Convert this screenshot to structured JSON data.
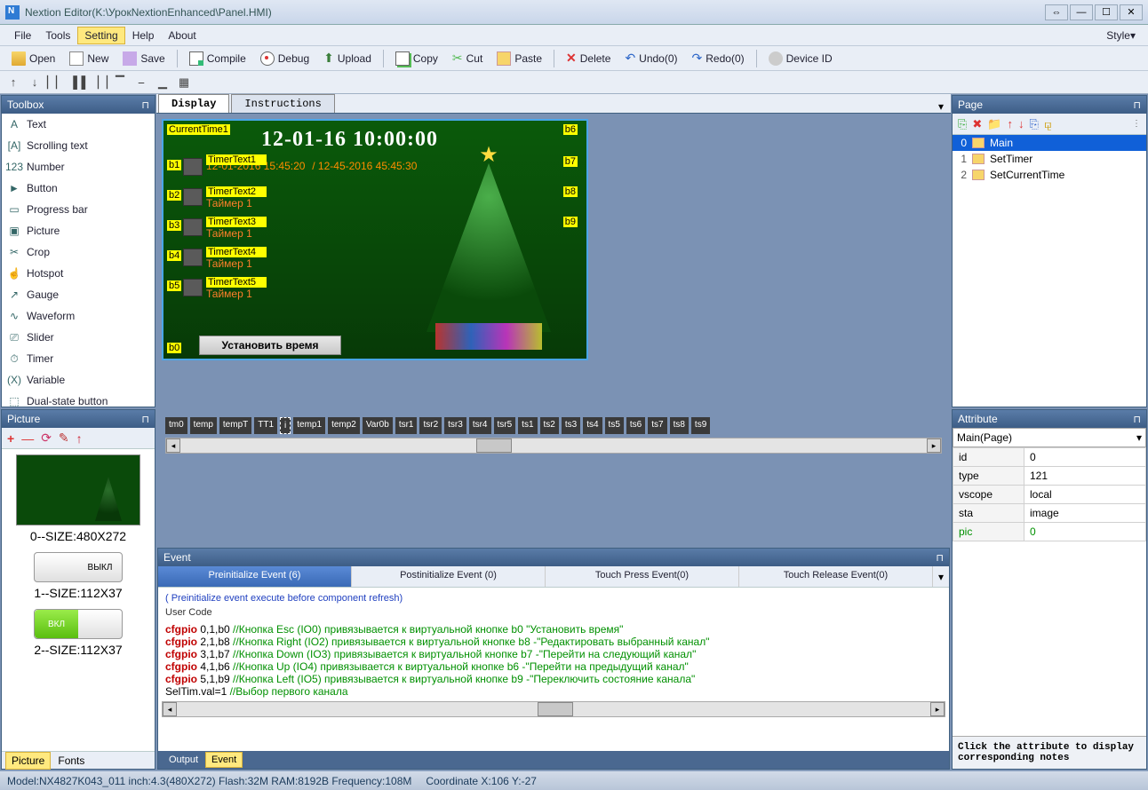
{
  "window": {
    "title": "Nextion Editor(K:\\УрокNextionEnhanced\\Panel.HMI)"
  },
  "menu": {
    "file": "File",
    "tools": "Tools",
    "setting": "Setting",
    "help": "Help",
    "about": "About",
    "style": "Style▾"
  },
  "tb1": {
    "open": "Open",
    "new": "New",
    "save": "Save",
    "compile": "Compile",
    "debug": "Debug",
    "upload": "Upload",
    "copy": "Copy",
    "cut": "Cut",
    "paste": "Paste",
    "delete": "Delete",
    "undo": "Undo(0)",
    "redo": "Redo(0)",
    "device": "Device ID"
  },
  "toolbox": {
    "title": "Toolbox",
    "items": [
      {
        "icon": "A",
        "label": "Text"
      },
      {
        "icon": "[A]",
        "label": "Scrolling text"
      },
      {
        "icon": "123",
        "label": "Number"
      },
      {
        "icon": "►",
        "label": "Button"
      },
      {
        "icon": "▭",
        "label": "Progress bar"
      },
      {
        "icon": "▣",
        "label": "Picture"
      },
      {
        "icon": "✂",
        "label": "Crop"
      },
      {
        "icon": "☝",
        "label": "Hotspot"
      },
      {
        "icon": "↗",
        "label": "Gauge"
      },
      {
        "icon": "∿",
        "label": "Waveform"
      },
      {
        "icon": "⎚",
        "label": "Slider"
      },
      {
        "icon": "⏱",
        "label": "Timer"
      },
      {
        "icon": "(X)",
        "label": "Variable"
      },
      {
        "icon": "⬚",
        "label": "Dual-state button"
      }
    ]
  },
  "picture": {
    "title": "Picture",
    "lab0": "0--SIZE:480X272",
    "lab1": "1--SIZE:112X37",
    "lab2": "2--SIZE:112X37",
    "off": "ВЫКЛ",
    "on": "ВКЛ",
    "tabs": {
      "pic": "Picture",
      "fonts": "Fonts"
    }
  },
  "tabs": {
    "display": "Display",
    "instr": "Instructions"
  },
  "canvas": {
    "labels": {
      "ct1": "CurrentTime1",
      "b0": "b0",
      "b1": "b1",
      "b2": "b2",
      "b3": "b3",
      "b4": "b4",
      "b5": "b5",
      "b6": "b6",
      "b7": "b7",
      "b8": "b8",
      "b9": "b9",
      "tt1": "TimerText1",
      "tt2": "TimerText2",
      "tt3": "TimerText3",
      "tt4": "TimerText4",
      "tt5": "TimerText5"
    },
    "bigtime": "12-01-16  10:00:00",
    "line2a": "12-01-2016 15:45:20",
    "line2b": "/ 12-45-2016 45:45:30",
    "timertxt": "Таймер 1",
    "setbtn": "Установить время"
  },
  "objstrip": [
    "tm0",
    "temp",
    "tempT",
    "TT1",
    "i",
    "temp1",
    "temp2",
    "Var0b",
    "tsr1",
    "tsr2",
    "tsr3",
    "tsr4",
    "tsr5",
    "ts1",
    "ts2",
    "ts3",
    "ts4",
    "ts5",
    "ts6",
    "ts7",
    "ts8",
    "ts9"
  ],
  "event": {
    "title": "Event",
    "tabs": {
      "pre": "Preinitialize Event (6)",
      "post": "Postinitialize Event (0)",
      "press": "Touch Press Event(0)",
      "rel": "Touch Release Event(0)"
    },
    "hint": "( Preinitialize event execute before component refresh)",
    "sub": "User Code",
    "code": [
      {
        "k": "cfgpio",
        "a": " 0,1,b0 ",
        "c": "//Кнопка Esc (IO0) привязывается к виртуальной кнопке b0 \"Установить время\""
      },
      {
        "k": "cfgpio",
        "a": " 2,1,b8 ",
        "c": "//Кнопка Right (IO2) привязывается к виртуальной кнопке b8 -\"Редактировать выбранный канал\""
      },
      {
        "k": "cfgpio",
        "a": " 3,1,b7 ",
        "c": "//Кнопка Down (IO3) привязывается к виртуальной кнопке b7 -\"Перейти на следующий канал\""
      },
      {
        "k": "cfgpio",
        "a": " 4,1,b6 ",
        "c": "//Кнопка Up (IO4) привязывается к виртуальной кнопке b6 -\"Перейти на предыдущий канал\""
      },
      {
        "k": "cfgpio",
        "a": " 5,1,b9 ",
        "c": "//Кнопка Left (IO5) привязывается к виртуальной кнопке b9 -\"Переключить состояние канала\""
      },
      {
        "k": "",
        "a": "SelTim.val=1 ",
        "c": "//Выбор первого канала"
      }
    ],
    "outtabs": {
      "output": "Output",
      "event": "Event"
    }
  },
  "page": {
    "title": "Page",
    "items": [
      {
        "idx": "0",
        "label": "Main"
      },
      {
        "idx": "1",
        "label": "SetTimer"
      },
      {
        "idx": "2",
        "label": "SetCurrentTime"
      }
    ]
  },
  "attr": {
    "title": "Attribute",
    "dd": "Main(Page)",
    "rows": [
      {
        "k": "id",
        "v": "0"
      },
      {
        "k": "type",
        "v": "121"
      },
      {
        "k": "vscope",
        "v": "local"
      },
      {
        "k": "sta",
        "v": "image"
      },
      {
        "k": "pic",
        "v": "0",
        "green": true
      }
    ],
    "hint": "Click the attribute to display corresponding notes"
  },
  "status": {
    "model": "Model:NX4827K043_011   inch:4.3(480X272)  Flash:32M RAM:8192B Frequency:108M",
    "coord": "Coordinate X:106  Y:-27"
  }
}
